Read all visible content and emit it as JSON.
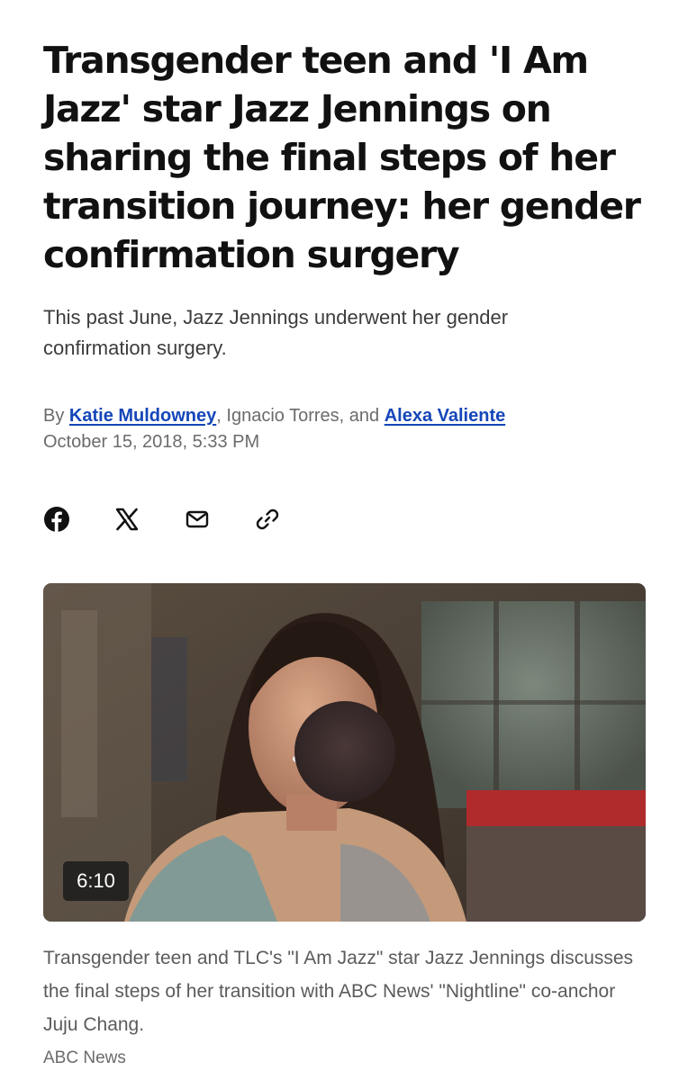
{
  "article": {
    "headline": "Transgender teen and 'I Am Jazz' star Jazz Jennings on sharing the final steps of her transition journey: her gender confirmation surgery",
    "subheadline": "This past June, Jazz Jennings underwent her gender confirmation surgery.",
    "byline": {
      "prefix": "By",
      "authors": [
        "Katie Muldowney",
        "Ignacio Torres",
        "Alexa Valiente"
      ],
      "sep_comma": ",",
      "sep_and": ", and",
      "date": "October 15, 2018, 5:33 PM"
    }
  },
  "share": [
    {
      "name": "facebook-icon"
    },
    {
      "name": "x-icon"
    },
    {
      "name": "email-icon"
    },
    {
      "name": "link-icon"
    }
  ],
  "video": {
    "duration": "6:10",
    "caption": "Transgender teen and TLC's \"I Am Jazz\" star Jazz Jennings discusses the final steps of her transition with ABC News' \"Nightline\" co-anchor Juju Chang.",
    "credit": "ABC News"
  },
  "colors": {
    "link": "#1446b8",
    "text": "#111111",
    "muted": "#6b6b6b"
  }
}
